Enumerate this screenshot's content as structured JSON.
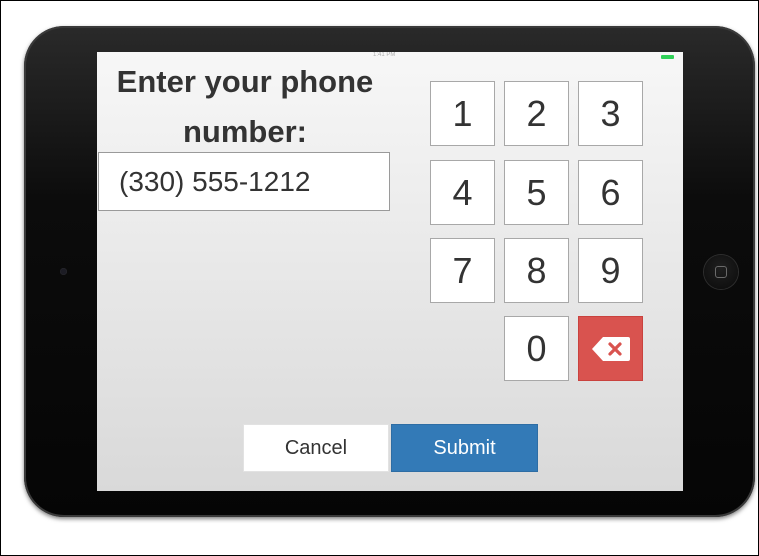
{
  "screen": {
    "status_time": "1:41 PM"
  },
  "prompt": {
    "line1": "Enter your phone",
    "line2": "number:"
  },
  "phone_input": {
    "value": "(330) 555-1212"
  },
  "keypad": {
    "keys": [
      "1",
      "2",
      "3",
      "4",
      "5",
      "6",
      "7",
      "8",
      "9",
      "0"
    ],
    "delete_icon": "backspace-x-icon"
  },
  "actions": {
    "cancel_label": "Cancel",
    "submit_label": "Submit"
  },
  "colors": {
    "submit": "#337ab7",
    "delete": "#d9534f",
    "battery": "#30d158"
  }
}
